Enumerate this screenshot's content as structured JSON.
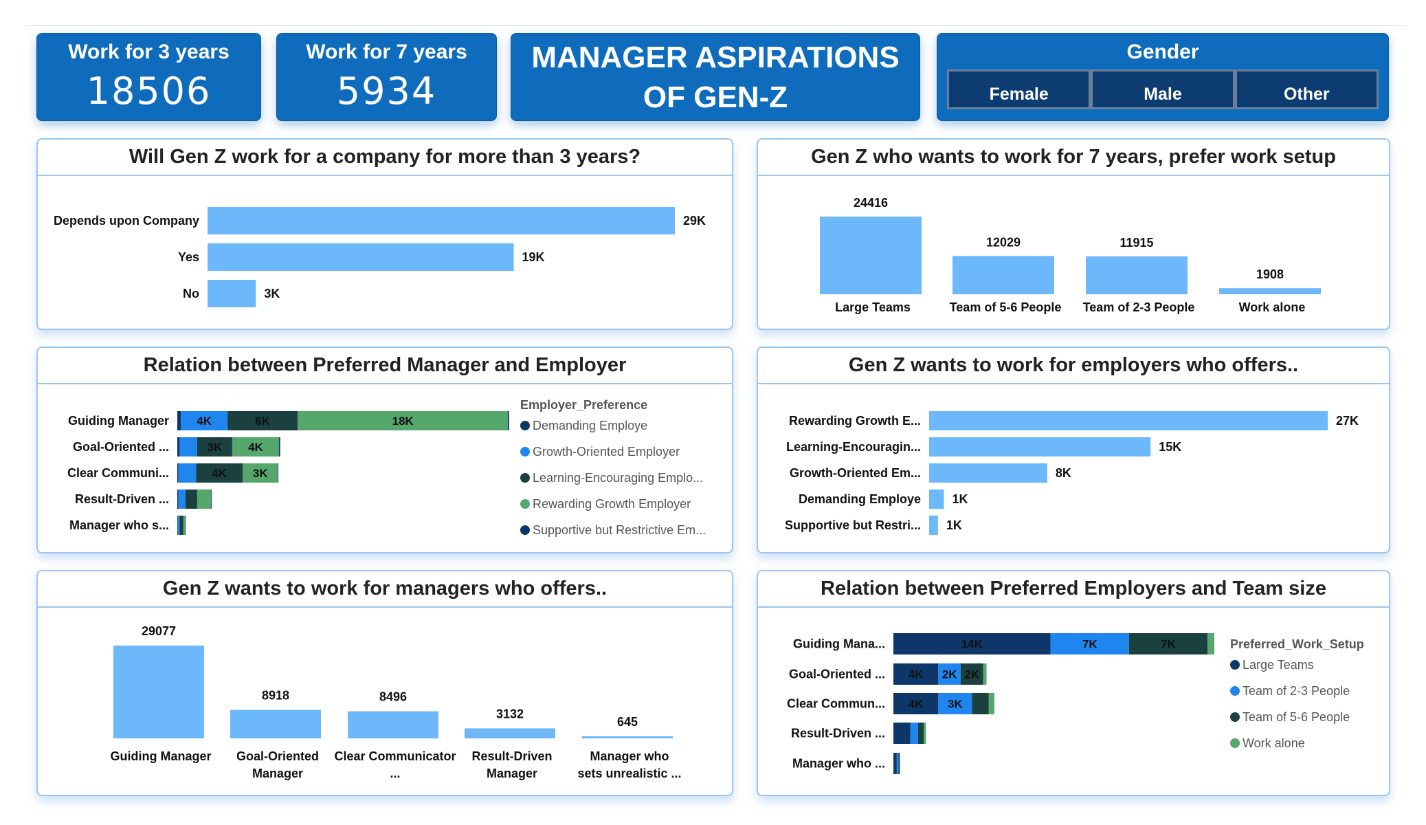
{
  "kpis": [
    {
      "title": "Work for 3 years",
      "value": "18506"
    },
    {
      "title": "Work for 7 years",
      "value": "5934"
    }
  ],
  "header": {
    "title_line1": "MANAGER ASPIRATIONS",
    "title_line2": "OF GEN-Z"
  },
  "gender": {
    "title": "Gender",
    "options": [
      "Female",
      "Male",
      "Other"
    ]
  },
  "colors": {
    "bar_light": "#6cb8fa",
    "navy": "#0e3668",
    "blue": "#1f86f0",
    "dark_teal": "#1b4040",
    "green": "#55a76c",
    "panel_border": "#9ec5ee",
    "header_blue": "#0f6cbd"
  },
  "panels": {
    "p1": {
      "title": "Will Gen Z work for a company for more than 3 years?"
    },
    "p2": {
      "title": "Gen Z who wants to work for 7 years, prefer work setup"
    },
    "p3": {
      "title": "Relation between Preferred Manager and Employer"
    },
    "p4": {
      "title": "Gen Z wants to work for employers who offers.."
    },
    "p5": {
      "title": "Gen Z wants to work for managers who offers.."
    },
    "p6": {
      "title": "Relation between Preferred Employers and Team size"
    }
  },
  "chart_data": [
    {
      "id": "p1",
      "type": "bar",
      "orientation": "horizontal",
      "categories": [
        "Depends upon Company",
        "Yes",
        "No"
      ],
      "values": [
        29000,
        19000,
        3000
      ],
      "data_labels": [
        "29K",
        "19K",
        "3K"
      ]
    },
    {
      "id": "p2",
      "type": "bar",
      "orientation": "vertical",
      "categories": [
        "Large Teams",
        "Team of 5-6 People",
        "Team of 2-3 People",
        "Work alone"
      ],
      "values": [
        24416,
        12029,
        11915,
        1908
      ],
      "data_labels": [
        "24416",
        "12029",
        "11915",
        "1908"
      ]
    },
    {
      "id": "p3",
      "type": "bar",
      "orientation": "horizontal",
      "stacked": true,
      "categories": [
        "Guiding Manager",
        "Goal-Oriented ...",
        "Clear Communi...",
        "Result-Driven ...",
        "Manager who s..."
      ],
      "legend_title": "Employer_Preference",
      "legend_position": "right",
      "series": [
        {
          "name": "Demanding Employe",
          "color": "#0e3668",
          "values": [
            0.3,
            0.2,
            0.1,
            0.1,
            0.05
          ]
        },
        {
          "name": "Growth-Oriented Employer",
          "color": "#1f86f0",
          "values": [
            4,
            1.5,
            1.5,
            0.6,
            0.15
          ]
        },
        {
          "name": "Learning-Encouraging Emplo...",
          "color": "#1b4040",
          "values": [
            6,
            3,
            4,
            1,
            0.3
          ]
        },
        {
          "name": "Rewarding Growth Employer",
          "color": "#55a76c",
          "values": [
            18,
            4,
            3,
            1.2,
            0.2
          ]
        },
        {
          "name": "Supportive but Restrictive Em...",
          "color": "#0e3668",
          "values": [
            0.1,
            0.1,
            0.05,
            0.05,
            0.02
          ]
        }
      ],
      "data_labels": [
        [
          "",
          "4K",
          "6K",
          "18K",
          ""
        ],
        [
          "",
          "",
          "3K",
          "4K",
          ""
        ],
        [
          "",
          "",
          "4K",
          "3K",
          ""
        ],
        [
          "",
          "",
          "",
          "",
          ""
        ],
        [
          "",
          "",
          "",
          "",
          ""
        ]
      ],
      "unit": "K"
    },
    {
      "id": "p4",
      "type": "bar",
      "orientation": "horizontal",
      "categories": [
        "Rewarding Growth E...",
        "Learning-Encouragin...",
        "Growth-Oriented Em...",
        "Demanding Employe",
        "Supportive but Restri..."
      ],
      "values": [
        27000,
        15000,
        8000,
        1000,
        600
      ],
      "data_labels": [
        "27K",
        "15K",
        "8K",
        "1K",
        "1K"
      ]
    },
    {
      "id": "p5",
      "type": "bar",
      "orientation": "vertical",
      "categories": [
        "Guiding Manager",
        "Goal-Oriented Manager",
        "Clear Communicator ...",
        "Result-Driven Manager",
        "Manager who sets unrealistic ..."
      ],
      "values": [
        29077,
        8918,
        8496,
        3132,
        645
      ],
      "data_labels": [
        "29077",
        "8918",
        "8496",
        "3132",
        "645"
      ]
    },
    {
      "id": "p6",
      "type": "bar",
      "orientation": "horizontal",
      "stacked": true,
      "categories": [
        "Guiding Mana...",
        "Goal-Oriented ...",
        "Clear Commun...",
        "Result-Driven ...",
        "Manager who ..."
      ],
      "legend_title": "Preferred_Work_Setup",
      "legend_position": "right",
      "series": [
        {
          "name": "Large Teams",
          "color": "#0e3668",
          "values": [
            14,
            4,
            4,
            1.5,
            0.3
          ]
        },
        {
          "name": "Team of 2-3 People",
          "color": "#1f86f0",
          "values": [
            7,
            2,
            3,
            0.7,
            0.15
          ]
        },
        {
          "name": "Team of 5-6 People",
          "color": "#1b4040",
          "values": [
            7,
            2,
            1.5,
            0.5,
            0.1
          ]
        },
        {
          "name": "Work alone",
          "color": "#55a76c",
          "values": [
            0.6,
            0.3,
            0.5,
            0.2,
            0.05
          ]
        }
      ],
      "data_labels": [
        [
          "14K",
          "7K",
          "7K",
          ""
        ],
        [
          "4K",
          "2K",
          "2K",
          ""
        ],
        [
          "4K",
          "3K",
          "",
          ""
        ],
        [
          "",
          "",
          "",
          ""
        ],
        [
          "",
          "",
          "",
          ""
        ]
      ],
      "unit": "K"
    }
  ]
}
